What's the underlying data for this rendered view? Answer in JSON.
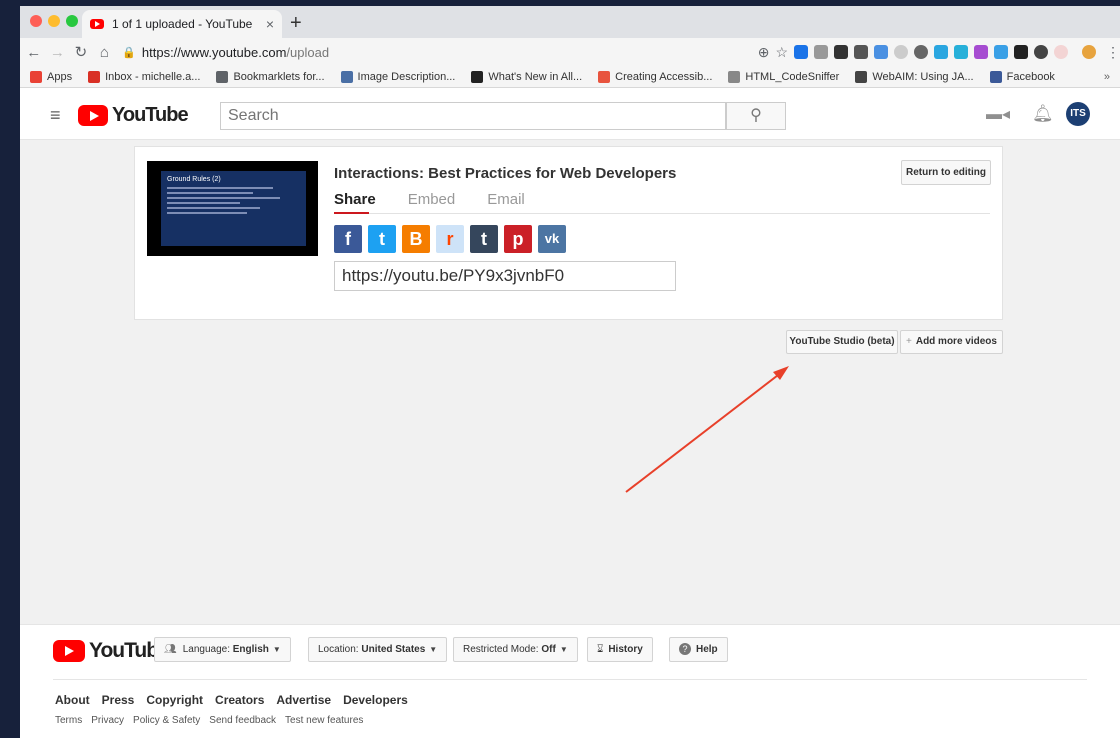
{
  "browser": {
    "tab_title": "1 of 1 uploaded - YouTube",
    "tab_close": "×",
    "new_tab": "+",
    "url_host": "https://www.youtube.com",
    "url_path": "/upload"
  },
  "bookmarks": [
    {
      "label": "Apps",
      "icon": "apps-grid-icon",
      "color": "#e94235"
    },
    {
      "label": "Inbox - michelle.a...",
      "icon": "gmail-icon",
      "color": "#d93025"
    },
    {
      "label": "Bookmarklets for...",
      "icon": "folder-icon",
      "color": "#5f6368"
    },
    {
      "label": "Image Description...",
      "icon": "image-icon",
      "color": "#4a6fa5"
    },
    {
      "label": "What's New in All...",
      "icon": "blackboard-icon",
      "color": "#222222"
    },
    {
      "label": "Creating Accessib...",
      "icon": "accessibility-icon",
      "color": "#e8543e"
    },
    {
      "label": "HTML_CodeSniffer",
      "icon": "page-icon",
      "color": "#888888"
    },
    {
      "label": "WebAIM: Using JA...",
      "icon": "webaim-icon",
      "color": "#444444"
    },
    {
      "label": "Facebook",
      "icon": "facebook-icon",
      "color": "#3b5998"
    }
  ],
  "bookmarks_more": "»",
  "youtube": {
    "wordmark": "YouTube",
    "search_placeholder": "Search",
    "avatar_initials": "ITS"
  },
  "upload": {
    "video_title": "Interactions: Best Practices for Web Developers",
    "share_tabs": [
      "Share",
      "Embed",
      "Email"
    ],
    "return_to_editing": "Return to editing",
    "short_url": "https://youtu.be/PY9x3jvnbF0",
    "thumbnail_heading": "Ground Rules (2)"
  },
  "socials": [
    {
      "name": "facebook",
      "glyph": "f",
      "color": "#3b5998"
    },
    {
      "name": "twitter",
      "glyph": "t",
      "color": "#1da1f2"
    },
    {
      "name": "blogger",
      "glyph": "B",
      "color": "#f57d00"
    },
    {
      "name": "reddit",
      "glyph": "r",
      "color": "#cee3f8"
    },
    {
      "name": "tumblr",
      "glyph": "t",
      "color": "#35465c"
    },
    {
      "name": "pinterest",
      "glyph": "p",
      "color": "#cb2027"
    },
    {
      "name": "vk",
      "glyph": "vk",
      "color": "#4c75a3"
    }
  ],
  "actions": {
    "studio": "YouTube Studio (beta)",
    "add_more": "Add more videos",
    "add_more_plus": "+"
  },
  "annotation": {
    "arrow_color": "#e8402a"
  },
  "footer": {
    "language_prefix": "Language: ",
    "language_value": "English",
    "location_prefix": "Location: ",
    "location_value": "United States",
    "restricted_prefix": "Restricted Mode: ",
    "restricted_value": "Off",
    "history": "History",
    "help": "Help",
    "links_primary": [
      "About",
      "Press",
      "Copyright",
      "Creators",
      "Advertise",
      "Developers"
    ],
    "links_secondary": [
      "Terms",
      "Privacy",
      "Policy & Safety",
      "Send feedback",
      "Test new features"
    ]
  }
}
